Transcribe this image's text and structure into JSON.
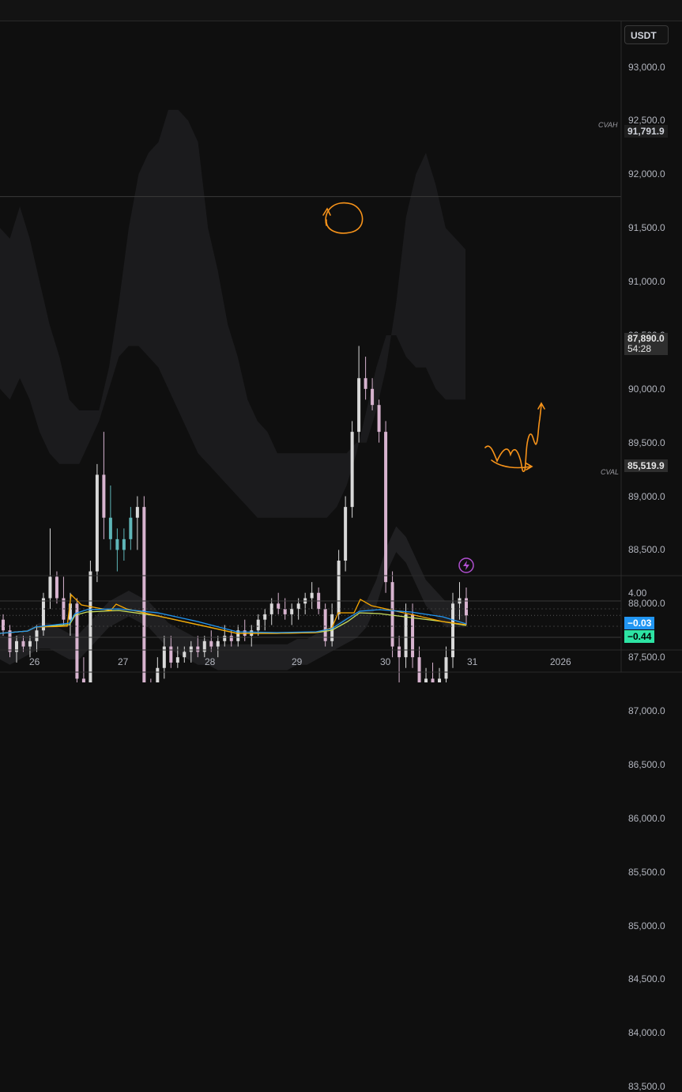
{
  "currency_button": "USDT",
  "price_axis": [
    "93,000.0",
    "92,500.0",
    "92,000.0",
    "91,500.0",
    "91,000.0",
    "90,500.0",
    "90,000.0",
    "89,500.0",
    "89,000.0",
    "88,500.0",
    "88,000.0",
    "87,500.0",
    "87,000.0",
    "86,500.0",
    "86,000.0",
    "85,500.0",
    "85,000.0",
    "84,500.0",
    "84,000.0",
    "83,500.0"
  ],
  "markers": {
    "cvah_label": "CVAH",
    "cvah_value": "91,791.9",
    "cval_label": "CVAL",
    "cval_value": "85,519.9",
    "last_price": "87,890.0",
    "countdown": "54:28"
  },
  "indicator_axis": {
    "top_value": "4.00",
    "badge_blue": "−0.03",
    "badge_green": "−0.44"
  },
  "time_axis": [
    "26",
    "27",
    "28",
    "29",
    "30",
    "31",
    "2026"
  ],
  "colors": {
    "background": "#0f0f0f",
    "candle_up": "#d9d9d9",
    "candle_down": "#d7b3cf",
    "candle_cyan": "#5fb6b8",
    "band_fill": "#1b1b1d",
    "annotation": "#f7931a",
    "osc_blue": "#2196f3",
    "osc_green": "#2de3a3",
    "osc_orange": "#f7a600",
    "osc_yellow": "#c8e060",
    "lightning": "#b04fd0"
  },
  "icons": [
    "lightning-icon"
  ],
  "chart_data": {
    "type": "candlestick",
    "ylim": [
      83300,
      93400
    ],
    "x_ticks": [
      "26",
      "27",
      "28",
      "29",
      "30",
      "31",
      "2026"
    ],
    "levels": {
      "cvah": 91791.9,
      "cval": 85519.9,
      "last": 87890.0
    },
    "upper_band_outer": [
      91500,
      91400,
      91700,
      91400,
      91000,
      90600,
      90300,
      89900,
      89800,
      89800,
      89800,
      90200,
      90800,
      91500,
      92000,
      92200,
      92300,
      92600,
      92600,
      92500,
      92300,
      91500,
      91100,
      90600,
      90300,
      89900,
      89700,
      89600,
      89400,
      89400,
      89400,
      89400,
      89400,
      89400,
      89400,
      89400,
      89500,
      89500,
      89800,
      90200,
      90800,
      91600,
      92000,
      92200,
      91900,
      91500,
      91400,
      91300
    ],
    "upper_band_inner": [
      90000,
      89900,
      90100,
      89900,
      89600,
      89400,
      89300,
      89300,
      89300,
      89500,
      89700,
      90000,
      90300,
      90400,
      90400,
      90300,
      90200,
      90000,
      89800,
      89600,
      89400,
      89300,
      89200,
      89100,
      89000,
      88900,
      88800,
      88800,
      88800,
      88800,
      88800,
      88800,
      88800,
      88800,
      88900,
      89100,
      89400,
      89800,
      90200,
      90500,
      90500,
      90300,
      90200,
      90200,
      90000,
      89900,
      89900,
      89900
    ],
    "mid_band": [
      87600,
      87550,
      87600,
      87650,
      87700,
      87700,
      87650,
      87600,
      87600,
      87700,
      87800,
      87900,
      87950,
      88000,
      87950,
      87900,
      87800,
      87700,
      87650,
      87600,
      87550,
      87550,
      87500,
      87500,
      87500,
      87500,
      87500,
      87500,
      87500,
      87500,
      87550,
      87550,
      87600,
      87650,
      87700,
      87750,
      87800,
      87900,
      88100,
      88400,
      88600,
      88500,
      88300,
      88100,
      88000,
      87900,
      87900,
      87900
    ],
    "lower_band_inner": [
      86300,
      86200,
      86100,
      86000,
      86000,
      85900,
      85900,
      86000,
      86100,
      86200,
      86300,
      86300,
      86300,
      86200,
      86200,
      86200,
      86200,
      86200,
      86200,
      86200,
      86200,
      86200,
      86200,
      86200,
      86200,
      86200,
      86300,
      86300,
      86300,
      86400,
      86500,
      86600,
      86700,
      86800,
      86800,
      86900,
      86900,
      87000,
      87000,
      86900,
      86700,
      86500,
      86400,
      86300,
      86200,
      86200,
      86100,
      86100
    ],
    "lower_band_outer": [
      84100,
      84000,
      84100,
      84100,
      84300,
      84500,
      84600,
      84500,
      84400,
      84200,
      84000,
      83800,
      83800,
      83800,
      83900,
      84000,
      84100,
      84200,
      84300,
      84300,
      84400,
      84400,
      84500,
      84600,
      84700,
      84800,
      84900,
      85000,
      85100,
      85200,
      85300,
      85300,
      85300,
      85300,
      85300,
      85300,
      85300,
      85300,
      85300,
      85300,
      85100,
      84900,
      84700,
      84600,
      84500,
      84500,
      84500,
      84600
    ],
    "candles": [
      [
        87850,
        87900,
        87700,
        87750
      ],
      [
        87750,
        87800,
        87500,
        87550
      ],
      [
        87550,
        87700,
        87450,
        87650
      ],
      [
        87650,
        87700,
        87550,
        87600
      ],
      [
        87600,
        87700,
        87500,
        87650
      ],
      [
        87650,
        87800,
        87550,
        87750
      ],
      [
        87750,
        88100,
        87700,
        88050
      ],
      [
        88050,
        88700,
        87950,
        88250
      ],
      [
        88250,
        88300,
        88000,
        88050
      ],
      [
        88050,
        88250,
        87800,
        87850
      ],
      [
        87850,
        88100,
        87700,
        88000
      ],
      [
        88000,
        88050,
        87200,
        87300
      ],
      [
        87300,
        87500,
        86900,
        87050
      ],
      [
        87050,
        88400,
        87000,
        88300
      ],
      [
        88300,
        89300,
        88200,
        89200
      ],
      [
        89200,
        89600,
        88600,
        88800
      ],
      [
        88800,
        89100,
        88500,
        88600
      ],
      [
        88600,
        88700,
        88300,
        88500
      ],
      [
        88500,
        88700,
        88400,
        88600
      ],
      [
        88600,
        88900,
        88500,
        88800
      ],
      [
        88800,
        89000,
        88500,
        88900
      ],
      [
        88900,
        89000,
        87100,
        87200
      ],
      [
        87200,
        87300,
        86700,
        86800
      ],
      [
        86800,
        87500,
        86700,
        87400
      ],
      [
        87400,
        87700,
        87300,
        87600
      ],
      [
        87600,
        87700,
        87400,
        87450
      ],
      [
        87450,
        87600,
        87400,
        87500
      ],
      [
        87500,
        87600,
        87450,
        87550
      ],
      [
        87550,
        87650,
        87450,
        87600
      ],
      [
        87600,
        87700,
        87500,
        87550
      ],
      [
        87550,
        87700,
        87500,
        87650
      ],
      [
        87650,
        87750,
        87550,
        87600
      ],
      [
        87600,
        87700,
        87500,
        87650
      ],
      [
        87650,
        87800,
        87600,
        87700
      ],
      [
        87700,
        87750,
        87600,
        87650
      ],
      [
        87650,
        87800,
        87600,
        87750
      ],
      [
        87750,
        87850,
        87650,
        87700
      ],
      [
        87700,
        87800,
        87600,
        87750
      ],
      [
        87750,
        87900,
        87700,
        87850
      ],
      [
        87850,
        87950,
        87750,
        87900
      ],
      [
        87900,
        88050,
        87800,
        88000
      ],
      [
        88000,
        88100,
        87900,
        87950
      ],
      [
        87950,
        88050,
        87850,
        87900
      ],
      [
        87900,
        88000,
        87800,
        87950
      ],
      [
        87950,
        88050,
        87850,
        88000
      ],
      [
        88000,
        88100,
        87900,
        88050
      ],
      [
        88050,
        88200,
        87950,
        88100
      ],
      [
        88100,
        88150,
        87900,
        87950
      ],
      [
        87950,
        88000,
        87600,
        87650
      ],
      [
        87650,
        88000,
        87600,
        87900
      ],
      [
        87900,
        88500,
        87850,
        88400
      ],
      [
        88400,
        89000,
        88300,
        88900
      ],
      [
        88900,
        89700,
        88800,
        89600
      ],
      [
        89600,
        90400,
        89500,
        90100
      ],
      [
        90100,
        90300,
        89900,
        90000
      ],
      [
        90000,
        90100,
        89800,
        89850
      ],
      [
        89850,
        89900,
        89500,
        89600
      ],
      [
        89600,
        89700,
        88100,
        88200
      ],
      [
        88200,
        88300,
        87500,
        87600
      ],
      [
        87600,
        87700,
        87000,
        87500
      ],
      [
        87500,
        88000,
        87400,
        87900
      ],
      [
        87900,
        88000,
        87400,
        87500
      ],
      [
        87500,
        87600,
        87100,
        87200
      ],
      [
        87200,
        87400,
        87000,
        87300
      ],
      [
        87300,
        87450,
        87100,
        87200
      ],
      [
        87200,
        87400,
        86900,
        87300
      ],
      [
        87300,
        87600,
        87200,
        87500
      ],
      [
        87500,
        88100,
        87400,
        88000
      ],
      [
        88000,
        88200,
        87850,
        88050
      ],
      [
        88050,
        88150,
        87800,
        87890
      ]
    ],
    "annotations": [
      "circle-at-peak",
      "arrow-zigzag-up"
    ],
    "oscillator": {
      "top_value": 4.0,
      "last_blue": -0.03,
      "last_green": -0.44
    }
  }
}
